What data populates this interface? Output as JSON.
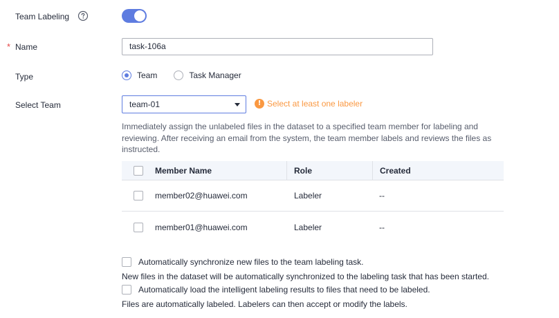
{
  "team_labeling": {
    "label": "Team Labeling",
    "enabled": true
  },
  "name": {
    "required_mark": "*",
    "label": "Name",
    "value": "task-106a"
  },
  "type": {
    "label": "Type",
    "options": [
      {
        "label": "Team",
        "checked": true
      },
      {
        "label": "Task Manager",
        "checked": false
      }
    ]
  },
  "select_team": {
    "label": "Select Team",
    "value": "team-01",
    "warning_icon": "!",
    "warning": "Select at least one labeler",
    "description": "Immediately assign the unlabeled files in the dataset to a specified team member for labeling and reviewing. After receiving an email from the system, the team member labels and reviews the files as instructed."
  },
  "members_table": {
    "columns": [
      "Member Name",
      "Role",
      "Created"
    ],
    "rows": [
      {
        "member": "member02@huawei.com",
        "role": "Labeler",
        "created": "--"
      },
      {
        "member": "member01@huawei.com",
        "role": "Labeler",
        "created": "--"
      }
    ]
  },
  "options": {
    "auto_sync_label": "Automatically synchronize new files to the team labeling task.",
    "auto_sync_note": "New files in the dataset will be automatically synchronized to the labeling task that has been started.",
    "auto_load_label": "Automatically load the intelligent labeling results to files that need to be labeled.",
    "auto_load_note": "Files are automatically labeled. Labelers can then accept or modify the labels."
  },
  "colors": {
    "accent": "#5e7ce0",
    "warning": "#fa9841",
    "required": "#e54545"
  },
  "icons": {
    "help": "question-circle-icon",
    "warning": "exclamation-circle-icon",
    "dropdown": "caret-down-icon"
  }
}
